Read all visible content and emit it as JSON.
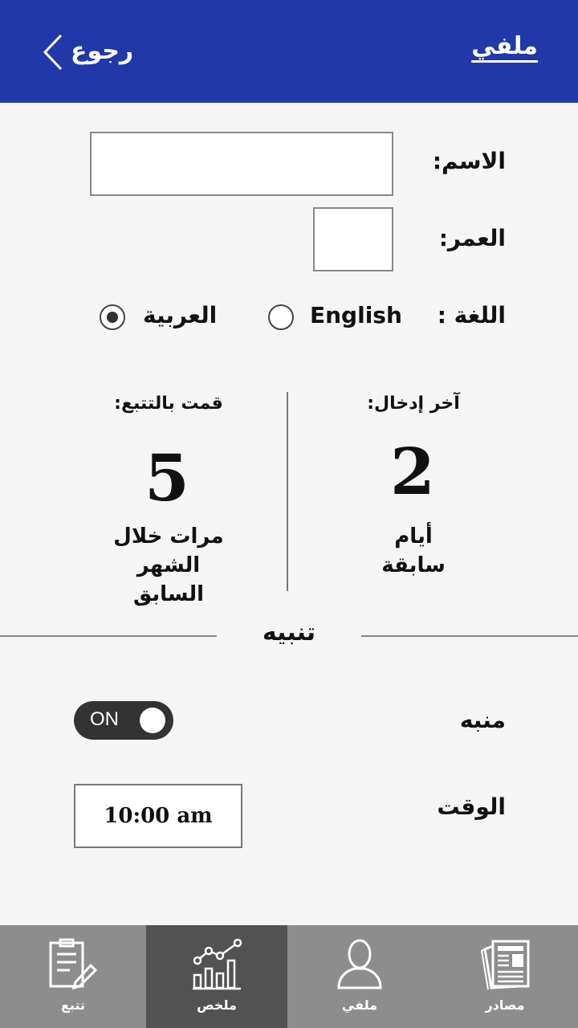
{
  "header": {
    "title": "ملفي",
    "back_label": "رجوع"
  },
  "profile": {
    "name_label": "الاسم:",
    "name_value": "",
    "age_label": "العمر:",
    "age_value": "",
    "language_label": "اللغة :",
    "language_options": [
      "English",
      "العربية"
    ],
    "language_selected": "العربية"
  },
  "stats": {
    "last_entry": {
      "heading": "آخر إدخال:",
      "value": "2",
      "subtitle": "أيام\nسابقة"
    },
    "tracked": {
      "heading": "قمت بالتتبع:",
      "value": "5",
      "subtitle": "مرات خلال\nالشهر\nالسابق"
    }
  },
  "alert": {
    "section_title": "تنبيه",
    "alarm_label": "منبه",
    "alarm_state": "ON",
    "time_label": "الوقت",
    "time_value": "10:00 am"
  },
  "nav": {
    "items": [
      {
        "label": "تتبع",
        "icon": "clipboard-edit-icon",
        "active": false
      },
      {
        "label": "ملخص",
        "icon": "chart-icon",
        "active": true
      },
      {
        "label": "ملفي",
        "icon": "user-icon",
        "active": false
      },
      {
        "label": "مصادر",
        "icon": "newspaper-icon",
        "active": false
      }
    ]
  },
  "colors": {
    "header_bg": "#2238a8",
    "nav_bg": "#8d8d8d",
    "nav_active_bg": "#525252"
  }
}
